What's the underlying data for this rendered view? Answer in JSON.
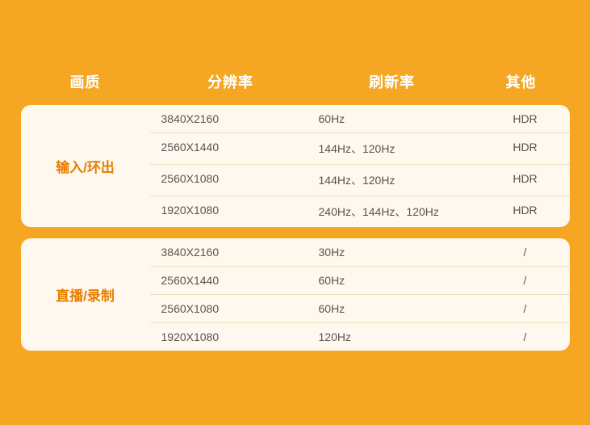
{
  "header": {
    "col1": "画质",
    "col2": "分辨率",
    "col3": "刷新率",
    "col4": "其他"
  },
  "sections": [
    {
      "category": "输入/环出",
      "rows": [
        {
          "resolution": "3840X2160",
          "refresh": "60Hz",
          "other": "HDR"
        },
        {
          "resolution": "2560X1440",
          "refresh": "144Hz、120Hz",
          "other": "HDR"
        },
        {
          "resolution": "2560X1080",
          "refresh": "144Hz、120Hz",
          "other": "HDR"
        },
        {
          "resolution": "1920X1080",
          "refresh": "240Hz、144Hz、120Hz",
          "other": "HDR"
        }
      ]
    },
    {
      "category": "直播/录制",
      "rows": [
        {
          "resolution": "3840X2160",
          "refresh": "30Hz",
          "other": "/"
        },
        {
          "resolution": "2560X1440",
          "refresh": "60Hz",
          "other": "/"
        },
        {
          "resolution": "2560X1080",
          "refresh": "60Hz",
          "other": "/"
        },
        {
          "resolution": "1920X1080",
          "refresh": "120Hz",
          "other": "/"
        }
      ]
    }
  ]
}
